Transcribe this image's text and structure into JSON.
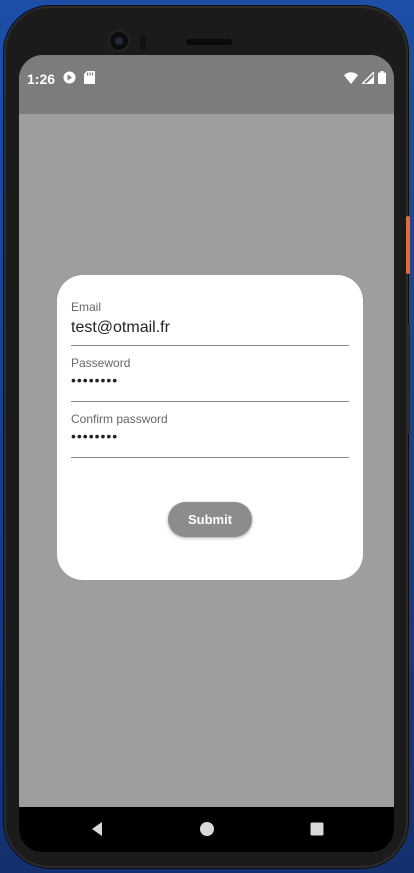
{
  "status_bar": {
    "time": "1:26",
    "left_icons": [
      "media-icon",
      "sd-card-icon"
    ],
    "right_icons": [
      "wifi-icon",
      "cell-signal-icon",
      "battery-icon"
    ]
  },
  "form": {
    "email": {
      "label": "Email",
      "value": "test@otmail.fr"
    },
    "password": {
      "label": "Passeword",
      "value": "••••••••"
    },
    "confirm_password": {
      "label": "Confirm password",
      "value": "••••••••"
    },
    "submit_label": "Submit"
  },
  "navigation": {
    "buttons": [
      "back-icon",
      "home-icon",
      "recents-icon"
    ]
  },
  "colors": {
    "screen_bg": "#9e9e9e",
    "status_bar_bg": "#7c7c7c",
    "card_bg": "#ffffff",
    "button_bg": "#8c8c8c",
    "accent_power_button": "#e06c3c"
  }
}
